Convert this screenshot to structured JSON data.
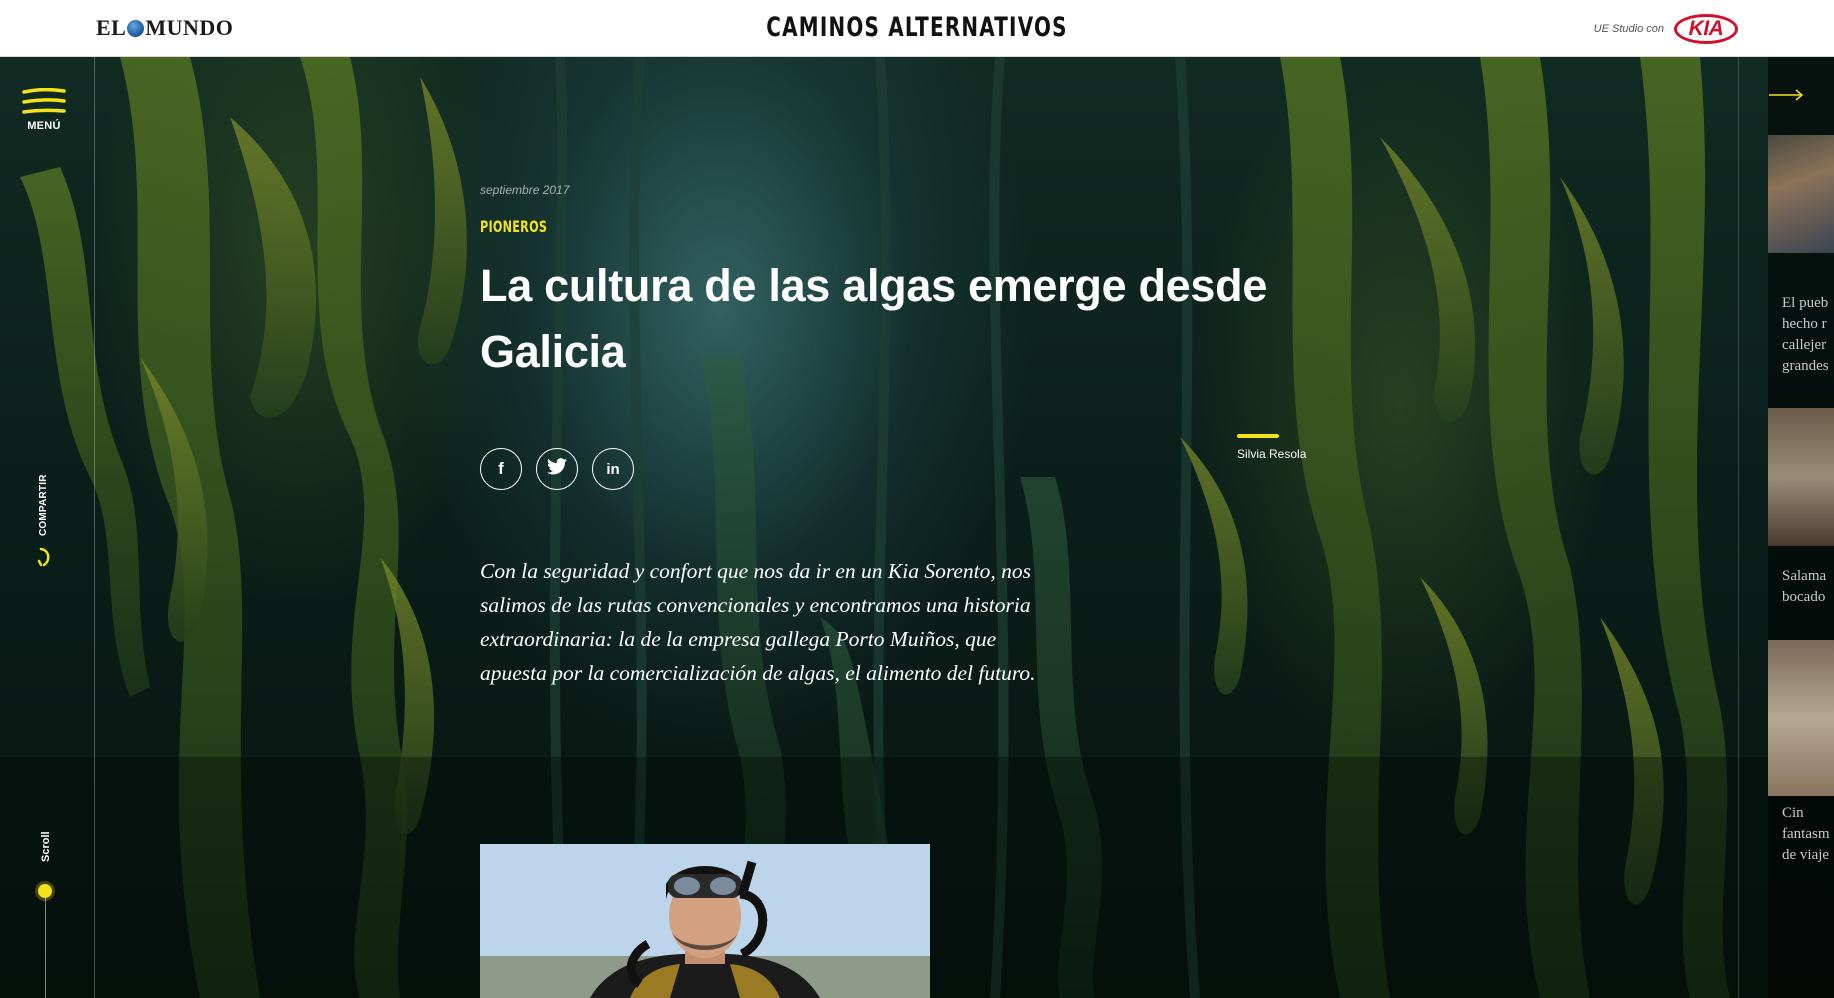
{
  "header": {
    "logo_left": "EL MUNDO",
    "logo_left_part1": "EL",
    "logo_left_part2": "MUNDO",
    "site_title": "CAMINOS ALTERNATIVOS",
    "sponsor_text": "UE Studio con",
    "sponsor_logo": "KIA"
  },
  "nav": {
    "menu_label": "MENÚ",
    "share_label": "COMPARTIR",
    "scroll_label": "Scroll"
  },
  "article": {
    "date": "septiembre 2017",
    "category": "PIONEROS",
    "headline": "La cultura de las algas emerge desde Galicia",
    "author": "Silvia Resola",
    "intro": "Con la seguridad y confort que nos da ir en un Kia Sorento, nos salimos de las rutas convencionales y encontramos una historia extraordinaria: la de la empresa gallega Porto Muiños, que apuesta por la comercialización de algas, el alimento del futuro.",
    "social": [
      {
        "icon": "facebook-icon",
        "glyph": "f"
      },
      {
        "icon": "twitter-icon",
        "glyph": "t"
      },
      {
        "icon": "linkedin-icon",
        "glyph": "in"
      }
    ]
  },
  "teasers": [
    {
      "text": [
        "El pueb",
        "hecho r",
        "callejer",
        "grandes"
      ]
    },
    {
      "text": [
        "Salama",
        "bocado"
      ]
    },
    {
      "text": [
        "Cin",
        "fantasm",
        "de viaje"
      ]
    }
  ],
  "colors": {
    "accent": "#f4e21b",
    "kia_red": "#d1112a",
    "topbar_bg": "#ffffff"
  }
}
